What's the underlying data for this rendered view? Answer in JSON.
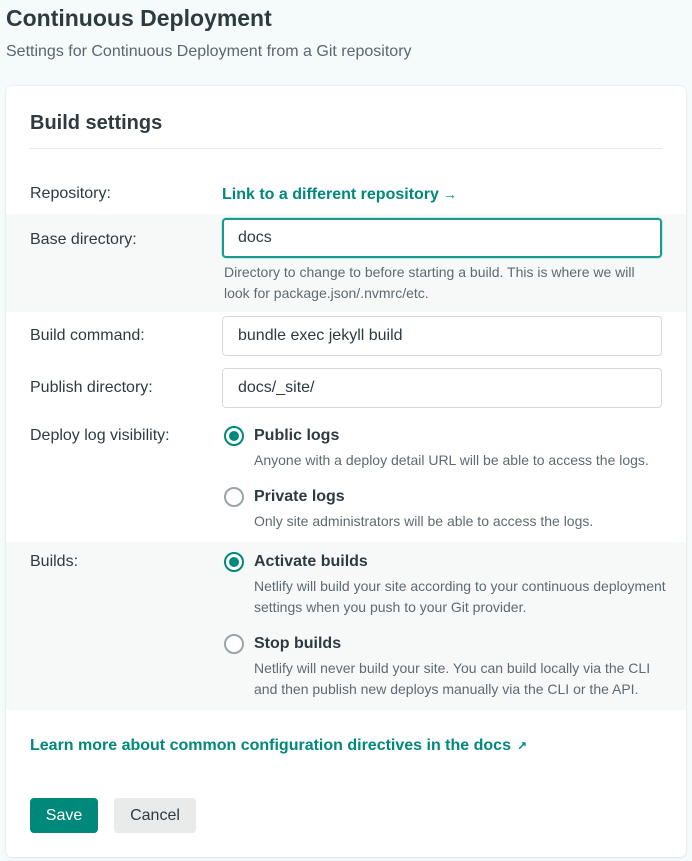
{
  "page": {
    "title": "Continuous Deployment",
    "subtitle": "Settings for Continuous Deployment from a Git repository"
  },
  "build_settings": {
    "title": "Build settings",
    "repository": {
      "label": "Repository:",
      "link_text": "Link to a different repository",
      "link_arrow": "→"
    },
    "base_directory": {
      "label": "Base directory:",
      "value": "docs",
      "help": "Directory to change to before starting a build. This is where we will look for package.json/.nvmrc/etc."
    },
    "build_command": {
      "label": "Build command:",
      "value": "bundle exec jekyll build"
    },
    "publish_directory": {
      "label": "Publish directory:",
      "value": "docs/_site/"
    },
    "deploy_log_visibility": {
      "label": "Deploy log visibility:",
      "options": [
        {
          "title": "Public logs",
          "description": "Anyone with a deploy detail URL will be able to access the logs.",
          "checked": true
        },
        {
          "title": "Private logs",
          "description": "Only site administrators will be able to access the logs.",
          "checked": false
        }
      ]
    },
    "builds": {
      "label": "Builds:",
      "options": [
        {
          "title": "Activate builds",
          "description": "Netlify will build your site according to your continuous deployment settings when you push to your Git provider.",
          "checked": true
        },
        {
          "title": "Stop builds",
          "description": "Netlify will never build your site. You can build locally via the CLI and then publish new deploys manually via the CLI or the API.",
          "checked": false
        }
      ]
    },
    "docs_link": {
      "text": "Learn more about common configuration directives in the docs",
      "arrow": "↗"
    },
    "buttons": {
      "save": "Save",
      "cancel": "Cancel"
    }
  },
  "colors": {
    "accent": "#00887a",
    "text": "#2d3b41",
    "muted": "#5d6a70"
  }
}
